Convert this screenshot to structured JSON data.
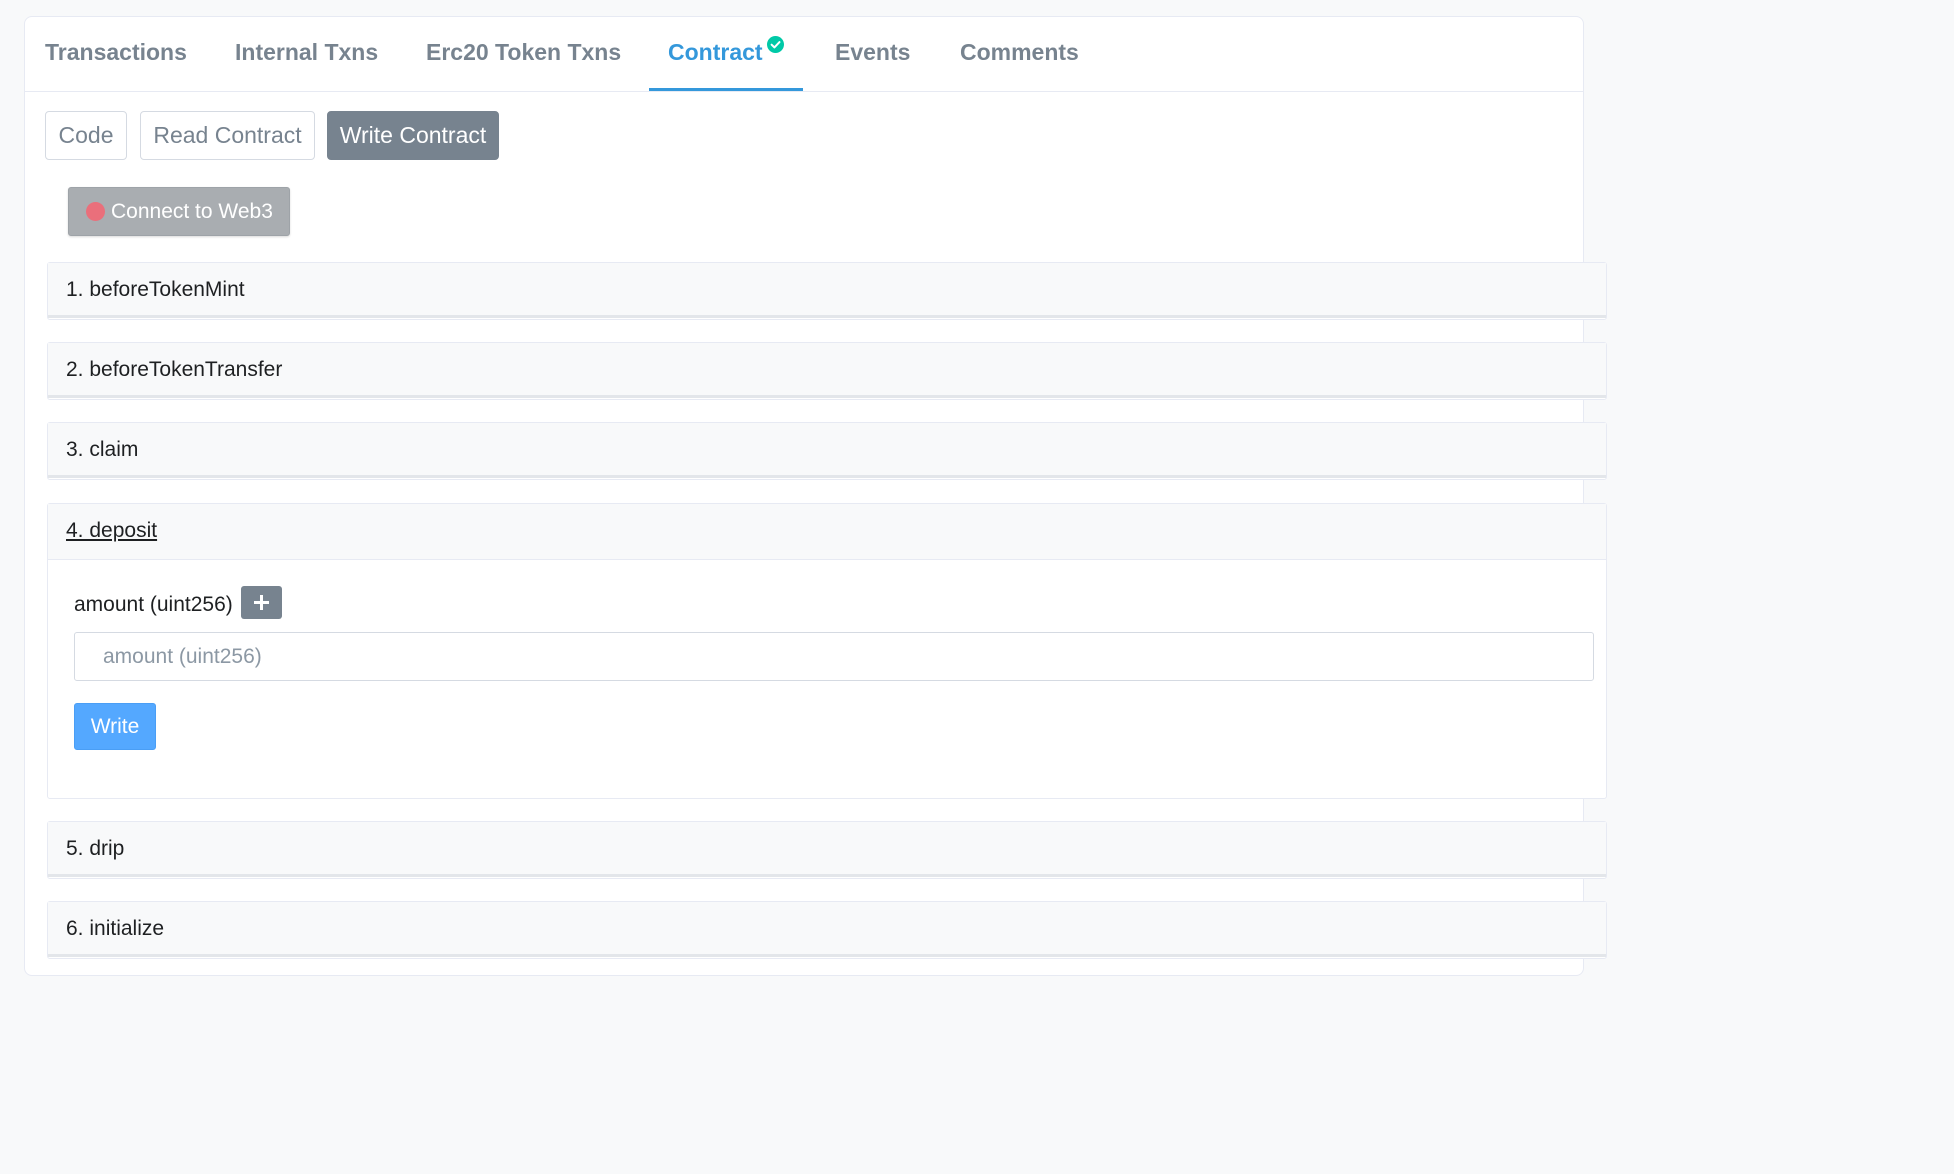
{
  "tabs": [
    {
      "label": "Transactions"
    },
    {
      "label": "Internal Txns"
    },
    {
      "label": "Erc20 Token Txns"
    },
    {
      "label": "Contract",
      "active": true,
      "verified_icon": "check-circle-icon"
    },
    {
      "label": "Events"
    },
    {
      "label": "Comments"
    }
  ],
  "subtabs": [
    {
      "label": "Code"
    },
    {
      "label": "Read Contract"
    },
    {
      "label": "Write Contract",
      "active": true
    }
  ],
  "connect": {
    "label": "Connect to Web3",
    "status_icon": "disconnected-dot-icon",
    "status_color": "#ea6f7b"
  },
  "functions": [
    {
      "label": "1. beforeTokenMint"
    },
    {
      "label": "2. beforeTokenTransfer"
    },
    {
      "label": "3. claim"
    },
    {
      "label": "4. deposit",
      "expanded": true,
      "param_label": "amount (uint256)",
      "param_placeholder": "amount (uint256)",
      "param_value": "",
      "write_label": "Write"
    },
    {
      "label": "5. drip"
    },
    {
      "label": "6. initialize"
    }
  ],
  "colors": {
    "accent": "#3498db",
    "verified": "#00c9a7",
    "write_button": "#54a8ff",
    "active_subtab": "#77838f"
  }
}
